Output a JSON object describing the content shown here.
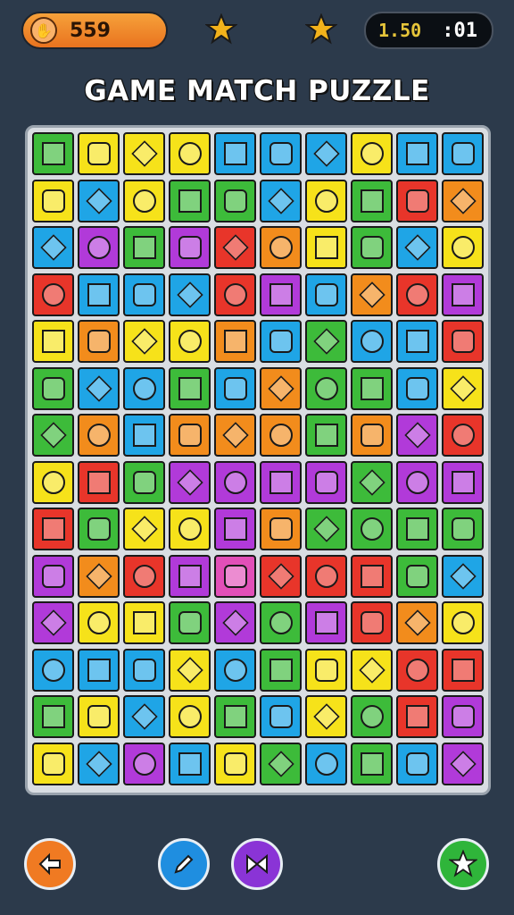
{
  "header": {
    "coins_value": "559",
    "timer_left": "1.50",
    "timer_right": ":01",
    "title": "GAME MATCH PUZZLE"
  },
  "colors": {
    "background": "#2c3a4b",
    "board": "#d9dde2",
    "coin_bar": "#ef8a2b",
    "star": "#f2b21b"
  },
  "grid": {
    "rows": 14,
    "cols": 10,
    "tiles": [
      [
        "green",
        "yellow",
        "yellow",
        "yellow",
        "blue",
        "blue",
        "blue",
        "yellow",
        "blue",
        "blue"
      ],
      [
        "yellow",
        "blue",
        "yellow",
        "green",
        "green",
        "blue",
        "yellow",
        "green",
        "red",
        "orange"
      ],
      [
        "blue",
        "purple",
        "green",
        "purple",
        "red",
        "orange",
        "yellow",
        "green",
        "blue",
        "yellow"
      ],
      [
        "red",
        "blue",
        "blue",
        "blue",
        "red",
        "purple",
        "blue",
        "orange",
        "red",
        "purple"
      ],
      [
        "yellow",
        "orange",
        "yellow",
        "yellow",
        "orange",
        "blue",
        "green",
        "blue",
        "blue",
        "red"
      ],
      [
        "green",
        "blue",
        "blue",
        "green",
        "blue",
        "orange",
        "green",
        "green",
        "blue",
        "yellow"
      ],
      [
        "green",
        "orange",
        "blue",
        "orange",
        "orange",
        "orange",
        "green",
        "orange",
        "purple",
        "red"
      ],
      [
        "yellow",
        "red",
        "green",
        "purple",
        "purple",
        "purple",
        "purple",
        "green",
        "purple",
        "purple"
      ],
      [
        "red",
        "green",
        "yellow",
        "yellow",
        "purple",
        "orange",
        "green",
        "green",
        "green",
        "green"
      ],
      [
        "purple",
        "orange",
        "red",
        "purple",
        "pink",
        "red",
        "red",
        "red",
        "green",
        "blue"
      ],
      [
        "purple",
        "yellow",
        "yellow",
        "green",
        "purple",
        "green",
        "purple",
        "red",
        "orange",
        "yellow"
      ],
      [
        "blue",
        "blue",
        "blue",
        "yellow",
        "blue",
        "green",
        "yellow",
        "yellow",
        "red",
        "red"
      ],
      [
        "green",
        "yellow",
        "blue",
        "yellow",
        "green",
        "blue",
        "yellow",
        "green",
        "red",
        "purple"
      ],
      [
        "yellow",
        "blue",
        "purple",
        "blue",
        "yellow",
        "green",
        "blue",
        "green",
        "blue",
        "purple"
      ]
    ],
    "palette": {
      "green": "#3dbb3a",
      "yellow": "#f6e21a",
      "blue": "#1fa5e6",
      "red": "#e8352a",
      "orange": "#f28c1c",
      "purple": "#b13ad9",
      "pink": "#e24fb8"
    }
  },
  "buttons": [
    {
      "name": "back-button",
      "icon": "left-arrow-icon",
      "color": "#f07a22"
    },
    {
      "name": "hint-button",
      "icon": "pencil-icon",
      "color": "#1f8ee0"
    },
    {
      "name": "shuffle-button",
      "icon": "bowtie-icon",
      "color": "#8a34d6"
    },
    {
      "name": "star-button",
      "icon": "star-icon",
      "color": "#2fb53a"
    }
  ]
}
